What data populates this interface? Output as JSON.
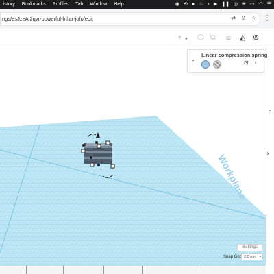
{
  "menubar": {
    "items": [
      "istory",
      "Bookmarks",
      "Profiles",
      "Tab",
      "Window",
      "Help"
    ],
    "status_icons": [
      "chrome-icon",
      "sync-icon",
      "record-icon",
      "flame-icon",
      "bell-icon",
      "play-icon",
      "pause-icon",
      "spotify-icon",
      "sparkle-icon",
      "battery-icon",
      "wifi-icon",
      "control-center-icon"
    ]
  },
  "browser": {
    "url": "ngs/esJzeAl2qvr-powerful-hillar-jofo/edit"
  },
  "inspector": {
    "title": "Linear compression spring"
  },
  "viewport": {
    "workplane_label": "Workplane"
  },
  "bottom": {
    "settings_label": "Settings",
    "snapgrid_label": "Snap Grid",
    "snapgrid_value": "2.0 mm"
  },
  "colors": {
    "grid_fill": "#bfe6f4",
    "grid_line": "#8fd0ea",
    "accent": "#2b2b2b"
  }
}
